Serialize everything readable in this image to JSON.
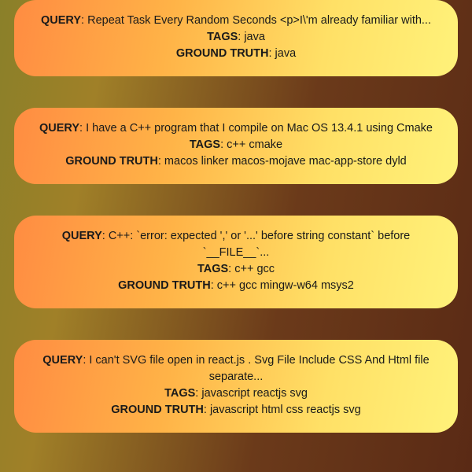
{
  "labels": {
    "query": "QUERY",
    "tags": "TAGS",
    "ground_truth": "GROUND TRUTH"
  },
  "cards": [
    {
      "query": "Repeat Task Every Random Seconds <p>I\\'m already familiar with...",
      "tags": "java",
      "ground_truth": "java"
    },
    {
      "query": "I have a C++ program that I compile on Mac OS 13.4.1 using Cmake",
      "tags": "c++ cmake",
      "ground_truth": "macos linker macos-mojave mac-app-store dyld"
    },
    {
      "query": "C++: `error: expected ',' or '...' before string constant` before `__FILE__`...",
      "tags": "c++ gcc",
      "ground_truth": "c++ gcc mingw-w64 msys2"
    },
    {
      "query": "I can't SVG file open in react.js . Svg File Include CSS And Html file separate...",
      "tags": "javascript reactjs svg",
      "ground_truth": "javascript html css reactjs svg"
    }
  ]
}
